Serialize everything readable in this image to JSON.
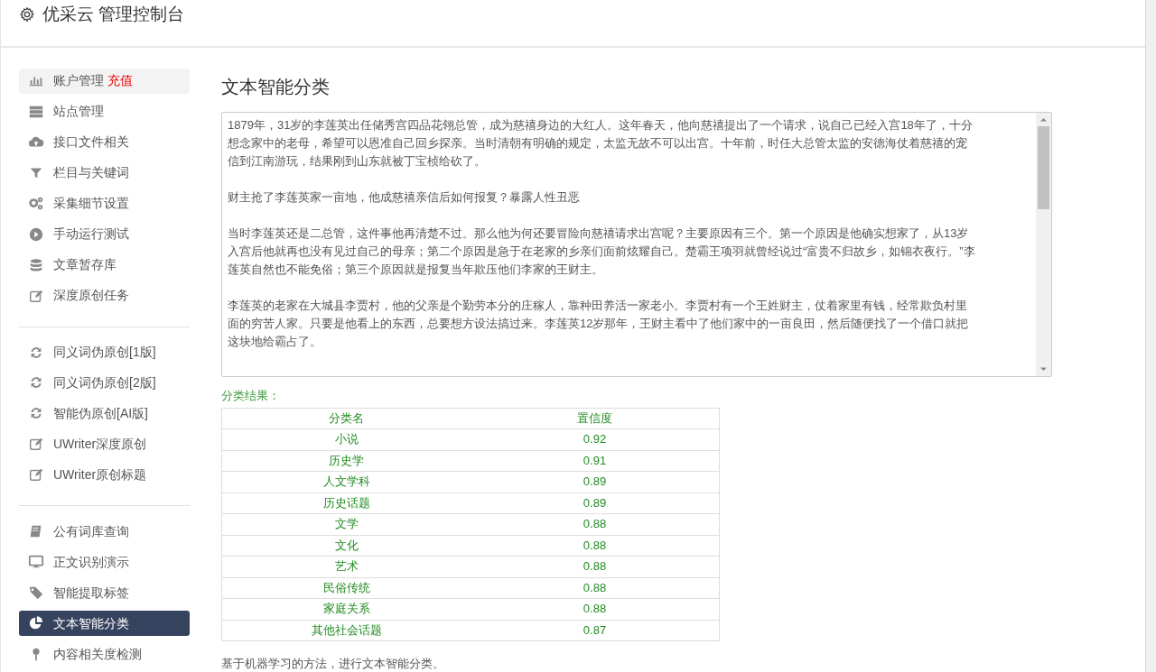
{
  "header": {
    "title": "优采云 管理控制台"
  },
  "sidebar": {
    "groups": [
      {
        "items": [
          {
            "label": "账户管理",
            "badge": "充值",
            "hovered": true,
            "selected": false
          },
          {
            "label": "站点管理",
            "hovered": false,
            "selected": false
          },
          {
            "label": "接口文件相关",
            "hovered": false,
            "selected": false
          },
          {
            "label": "栏目与关键词",
            "hovered": false,
            "selected": false
          },
          {
            "label": "采集细节设置",
            "hovered": false,
            "selected": false
          },
          {
            "label": "手动运行测试",
            "hovered": false,
            "selected": false
          },
          {
            "label": "文章暂存库",
            "hovered": false,
            "selected": false
          },
          {
            "label": "深度原创任务",
            "hovered": false,
            "selected": false
          }
        ]
      },
      {
        "items": [
          {
            "label": "同义词伪原创[1版]",
            "hovered": false,
            "selected": false
          },
          {
            "label": "同义词伪原创[2版]",
            "hovered": false,
            "selected": false
          },
          {
            "label": "智能伪原创[AI版]",
            "hovered": false,
            "selected": false
          },
          {
            "label": "UWriter深度原创",
            "hovered": false,
            "selected": false
          },
          {
            "label": "UWriter原创标题",
            "hovered": false,
            "selected": false
          }
        ]
      },
      {
        "items": [
          {
            "label": "公有词库查询",
            "hovered": false,
            "selected": false
          },
          {
            "label": "正文识别演示",
            "hovered": false,
            "selected": false
          },
          {
            "label": "智能提取标签",
            "hovered": false,
            "selected": false
          },
          {
            "label": "文本智能分类",
            "hovered": false,
            "selected": true
          },
          {
            "label": "内容相关度检测",
            "hovered": false,
            "selected": false
          }
        ]
      }
    ]
  },
  "main": {
    "title": "文本智能分类",
    "input": {
      "paragraphs": [
        "1879年，31岁的李莲英出任储秀宫四品花翎总管，成为慈禧身边的大红人。这年春天，他向慈禧提出了一个请求，说自己已经入宫18年了，十分想念家中的老母，希望可以恩准自己回乡探亲。当时清朝有明确的规定，太监无故不可以出宫。十年前，时任大总管太监的安德海仗着慈禧的宠信到江南游玩，结果刚到山东就被丁宝桢给砍了。",
        "财主抢了李莲英家一亩地，他成慈禧亲信后如何报复？暴露人性丑恶",
        "当时李莲英还是二总管，这件事他再清楚不过。那么他为何还要冒险向慈禧请求出宫呢？主要原因有三个。第一个原因是他确实想家了，从13岁入宫后他就再也没有见过自己的母亲；第二个原因是急于在老家的乡亲们面前炫耀自己。楚霸王项羽就曾经说过“富贵不归故乡，如锦衣夜行。”李莲英自然也不能免俗；第三个原因就是报复当年欺压他们李家的王财主。",
        "李莲英的老家在大城县李贾村，他的父亲是个勤劳本分的庄稼人，靠种田养活一家老小。李贾村有一个王姓财主，仗着家里有钱，经常欺负村里面的穷苦人家。只要是他看上的东西，总要想方设法搞过来。李莲英12岁那年，王财主看中了他们家中的一亩良田，然后随便找了一个借口就把这块地给霸占了。"
      ]
    },
    "result_label": "分类结果：",
    "table": {
      "columns": [
        "分类名",
        "置信度"
      ],
      "rows": [
        [
          "小说",
          "0.92"
        ],
        [
          "历史学",
          "0.91"
        ],
        [
          "人文学科",
          "0.89"
        ],
        [
          "历史话题",
          "0.89"
        ],
        [
          "文学",
          "0.88"
        ],
        [
          "文化",
          "0.88"
        ],
        [
          "艺术",
          "0.88"
        ],
        [
          "民俗传统",
          "0.88"
        ],
        [
          "家庭关系",
          "0.88"
        ],
        [
          "其他社会话题",
          "0.87"
        ]
      ]
    },
    "footer_note": "基于机器学习的方法，进行文本智能分类。"
  }
}
